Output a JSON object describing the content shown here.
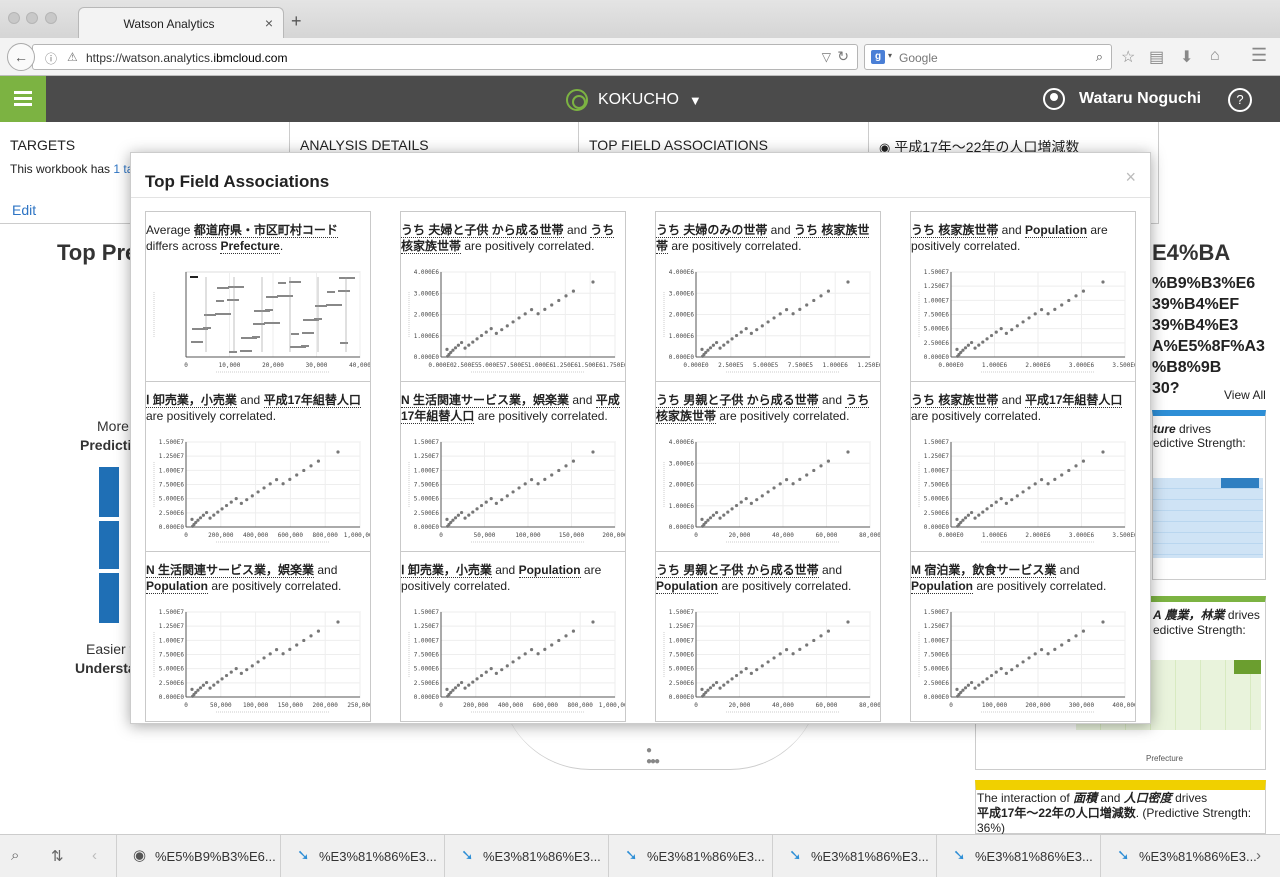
{
  "browser": {
    "tab_title": "Watson Analytics",
    "tab_close": "×",
    "new_tab": "+",
    "url_prefix": "https://watson.analytics.",
    "url_domain": "ibmcloud.com",
    "search_placeholder": "Google"
  },
  "header": {
    "project": "KOKUCHO",
    "user_name": "Wataru Noguchi",
    "help": "?"
  },
  "panels": [
    {
      "title": "TARGETS",
      "body_prefix": "This workbook has ",
      "body_link": "1 ta",
      "edit": "Edit"
    },
    {
      "title": "ANALYSIS DETAILS"
    },
    {
      "title": "TOP FIELD ASSOCIATIONS"
    },
    {
      "title": "平成17年～22年の人口増減数"
    }
  ],
  "background": {
    "top_pre": "Top Pre",
    "more": "More",
    "predicti": "Predicti",
    "easier": "Easier t",
    "understa": "Understa",
    "encoded_lines": [
      "E4%BA",
      "%B9%B3%E6",
      "39%B4%EF",
      "39%B4%E3",
      "A%E5%8F%A3",
      "%B8%9B",
      "30?"
    ],
    "view_all": "View All",
    "right_card1_a": "ture",
    "right_card1_b": " drives",
    "right_card1_c": "edictive Strength:",
    "right_card2_a": "A 農業，林業",
    "right_card2_b": " drives",
    "right_card2_c": "edictive Strength:",
    "right_card3_pre": "The interaction of ",
    "right_card3_f1": "面積",
    "right_card3_and": " and ",
    "right_card3_f2": "人口密度",
    "right_card3_drives": " drives",
    "right_card3_target": "平成17年～22年の人口増減数",
    "right_card3_post": ". (Predictive Strength:",
    "right_card3_pct": "36%)",
    "heatmap_label": "Prefecture"
  },
  "modal": {
    "title": "Top Field Associations",
    "close": "×",
    "cards": [
      {
        "pre": "Average ",
        "f1": "都道府県・市区町村コード",
        "mid": " differs across ",
        "f2": "Prefecture",
        "post": ".",
        "chart": "bars",
        "xticks": [
          "0",
          "10,000",
          "20,000",
          "30,000",
          "40,000"
        ],
        "yticks": []
      },
      {
        "pre": "",
        "f1": "うち 夫婦と子供 から成る世帯",
        "mid": " and ",
        "f2": "うち 核家族世帯",
        "post": " are positively correlated.",
        "chart": "scatter",
        "xticks": [
          "0.000E0",
          "2.500E5",
          "5.000E5",
          "7.500E5",
          "1.000E6",
          "1.250E6",
          "1.500E6",
          "1.750E6"
        ],
        "yticks": [
          "0.000E0",
          "1.000E6",
          "2.000E6",
          "3.000E6",
          "4.000E6"
        ]
      },
      {
        "pre": "",
        "f1": "うち 夫婦のみの世帯",
        "mid": " and ",
        "f2": "うち 核家族世帯",
        "post": " are positively correlated.",
        "chart": "scatter",
        "xticks": [
          "0.000E0",
          "2.500E5",
          "5.000E5",
          "7.500E5",
          "1.000E6",
          "1.250E6"
        ],
        "yticks": [
          "0.000E0",
          "1.000E6",
          "2.000E6",
          "3.000E6",
          "4.000E6"
        ]
      },
      {
        "pre": "",
        "f1": "うち 核家族世帯",
        "mid": " and ",
        "f2": "Population",
        "post": " are positively correlated.",
        "chart": "scatter",
        "xticks": [
          "0.000E0",
          "1.000E6",
          "2.000E6",
          "3.000E6",
          "3.500E6"
        ],
        "yticks": [
          "0.000E0",
          "2.500E6",
          "5.000E6",
          "7.500E6",
          "1.000E7",
          "1.250E7",
          "1.500E7"
        ]
      },
      {
        "pre": "",
        "f1": "Ⅰ 卸売業，小売業",
        "mid": " and ",
        "f2": "平成17年組替人口",
        "post": " are positively correlated.",
        "chart": "scatter",
        "xticks": [
          "0",
          "200,000",
          "400,000",
          "600,000",
          "800,000",
          "1,000,000"
        ],
        "yticks": [
          "0.000E0",
          "2.500E6",
          "5.000E6",
          "7.500E6",
          "1.000E7",
          "1.250E7",
          "1.500E7"
        ]
      },
      {
        "pre": "",
        "f1": "N 生活関連サービス業，娯楽業",
        "mid": " and ",
        "f2": "平成17年組替人口",
        "post": " are positively correlated.",
        "chart": "scatter",
        "xticks": [
          "0",
          "50,000",
          "100,000",
          "150,000",
          "200,000"
        ],
        "yticks": [
          "0.000E0",
          "2.500E6",
          "5.000E6",
          "7.500E6",
          "1.000E7",
          "1.250E7",
          "1.500E7"
        ]
      },
      {
        "pre": "",
        "f1": "うち 男親と子供 から成る世帯",
        "mid": " and ",
        "f2": "うち 核家族世帯",
        "post": " are positively correlated.",
        "chart": "scatter",
        "xticks": [
          "0",
          "20,000",
          "40,000",
          "60,000",
          "80,000"
        ],
        "yticks": [
          "0.000E0",
          "1.000E6",
          "2.000E6",
          "3.000E6",
          "4.000E6"
        ]
      },
      {
        "pre": "",
        "f1": "うち 核家族世帯",
        "mid": " and ",
        "f2": "平成17年組替人口",
        "post": " are positively correlated.",
        "chart": "scatter",
        "xticks": [
          "0.000E0",
          "1.000E6",
          "2.000E6",
          "3.000E6",
          "3.500E6"
        ],
        "yticks": [
          "0.000E0",
          "2.500E6",
          "5.000E6",
          "7.500E6",
          "1.000E7",
          "1.250E7",
          "1.500E7"
        ]
      },
      {
        "pre": "",
        "f1": "N 生活関連サービス業，娯楽業",
        "mid": " and ",
        "f2": "Population",
        "post": " are positively correlated.",
        "chart": "scatter",
        "xticks": [
          "0",
          "50,000",
          "100,000",
          "150,000",
          "200,000",
          "250,000"
        ],
        "yticks": [
          "0.000E0",
          "2.500E6",
          "5.000E6",
          "7.500E6",
          "1.000E7",
          "1.250E7",
          "1.500E7"
        ]
      },
      {
        "pre": "",
        "f1": "Ⅰ 卸売業，小売業",
        "mid": " and ",
        "f2": "Population",
        "post": " are positively correlated.",
        "chart": "scatter",
        "xticks": [
          "0",
          "200,000",
          "400,000",
          "600,000",
          "800,000",
          "1,000,000"
        ],
        "yticks": [
          "0.000E0",
          "2.500E6",
          "5.000E6",
          "7.500E6",
          "1.000E7",
          "1.250E7",
          "1.500E7"
        ]
      },
      {
        "pre": "",
        "f1": "うち 男親と子供 から成る世帯",
        "mid": " and ",
        "f2": "Population",
        "post": " are positively correlated.",
        "chart": "scatter",
        "xticks": [
          "0",
          "20,000",
          "40,000",
          "60,000",
          "80,000"
        ],
        "yticks": [
          "0.000E0",
          "2.500E6",
          "5.000E6",
          "7.500E6",
          "1.000E7",
          "1.250E7",
          "1.500E7"
        ]
      },
      {
        "pre": "",
        "f1": "M 宿泊業，飲食サービス業",
        "mid": " and ",
        "f2": "Population",
        "post": " are positively correlated.",
        "chart": "scatter",
        "xticks": [
          "0",
          "100,000",
          "200,000",
          "300,000",
          "400,000"
        ],
        "yticks": [
          "0.000E0",
          "2.500E6",
          "5.000E6",
          "7.500E6",
          "1.000E7",
          "1.250E7",
          "1.500E7"
        ]
      }
    ]
  },
  "bottom_tabs": [
    {
      "label": "%E5%B9%B3%E6...",
      "icon": "radio-icon"
    },
    {
      "label": "%E3%81%86%E3...",
      "icon": "arrow-icon"
    },
    {
      "label": "%E3%81%86%E3...",
      "icon": "arrow-icon"
    },
    {
      "label": "%E3%81%86%E3...",
      "icon": "arrow-icon"
    },
    {
      "label": "%E3%81%86%E3...",
      "icon": "arrow-icon"
    },
    {
      "label": "%E3%81%86%E3...",
      "icon": "arrow-icon"
    },
    {
      "label": "%E3%81%86%E3...",
      "icon": "arrow-icon"
    }
  ],
  "colors": {
    "accent": "#7cb342",
    "header": "#4b4b4b",
    "bar_blue": "#1f6fb5",
    "arrow_blue": "#2d8ed6"
  }
}
